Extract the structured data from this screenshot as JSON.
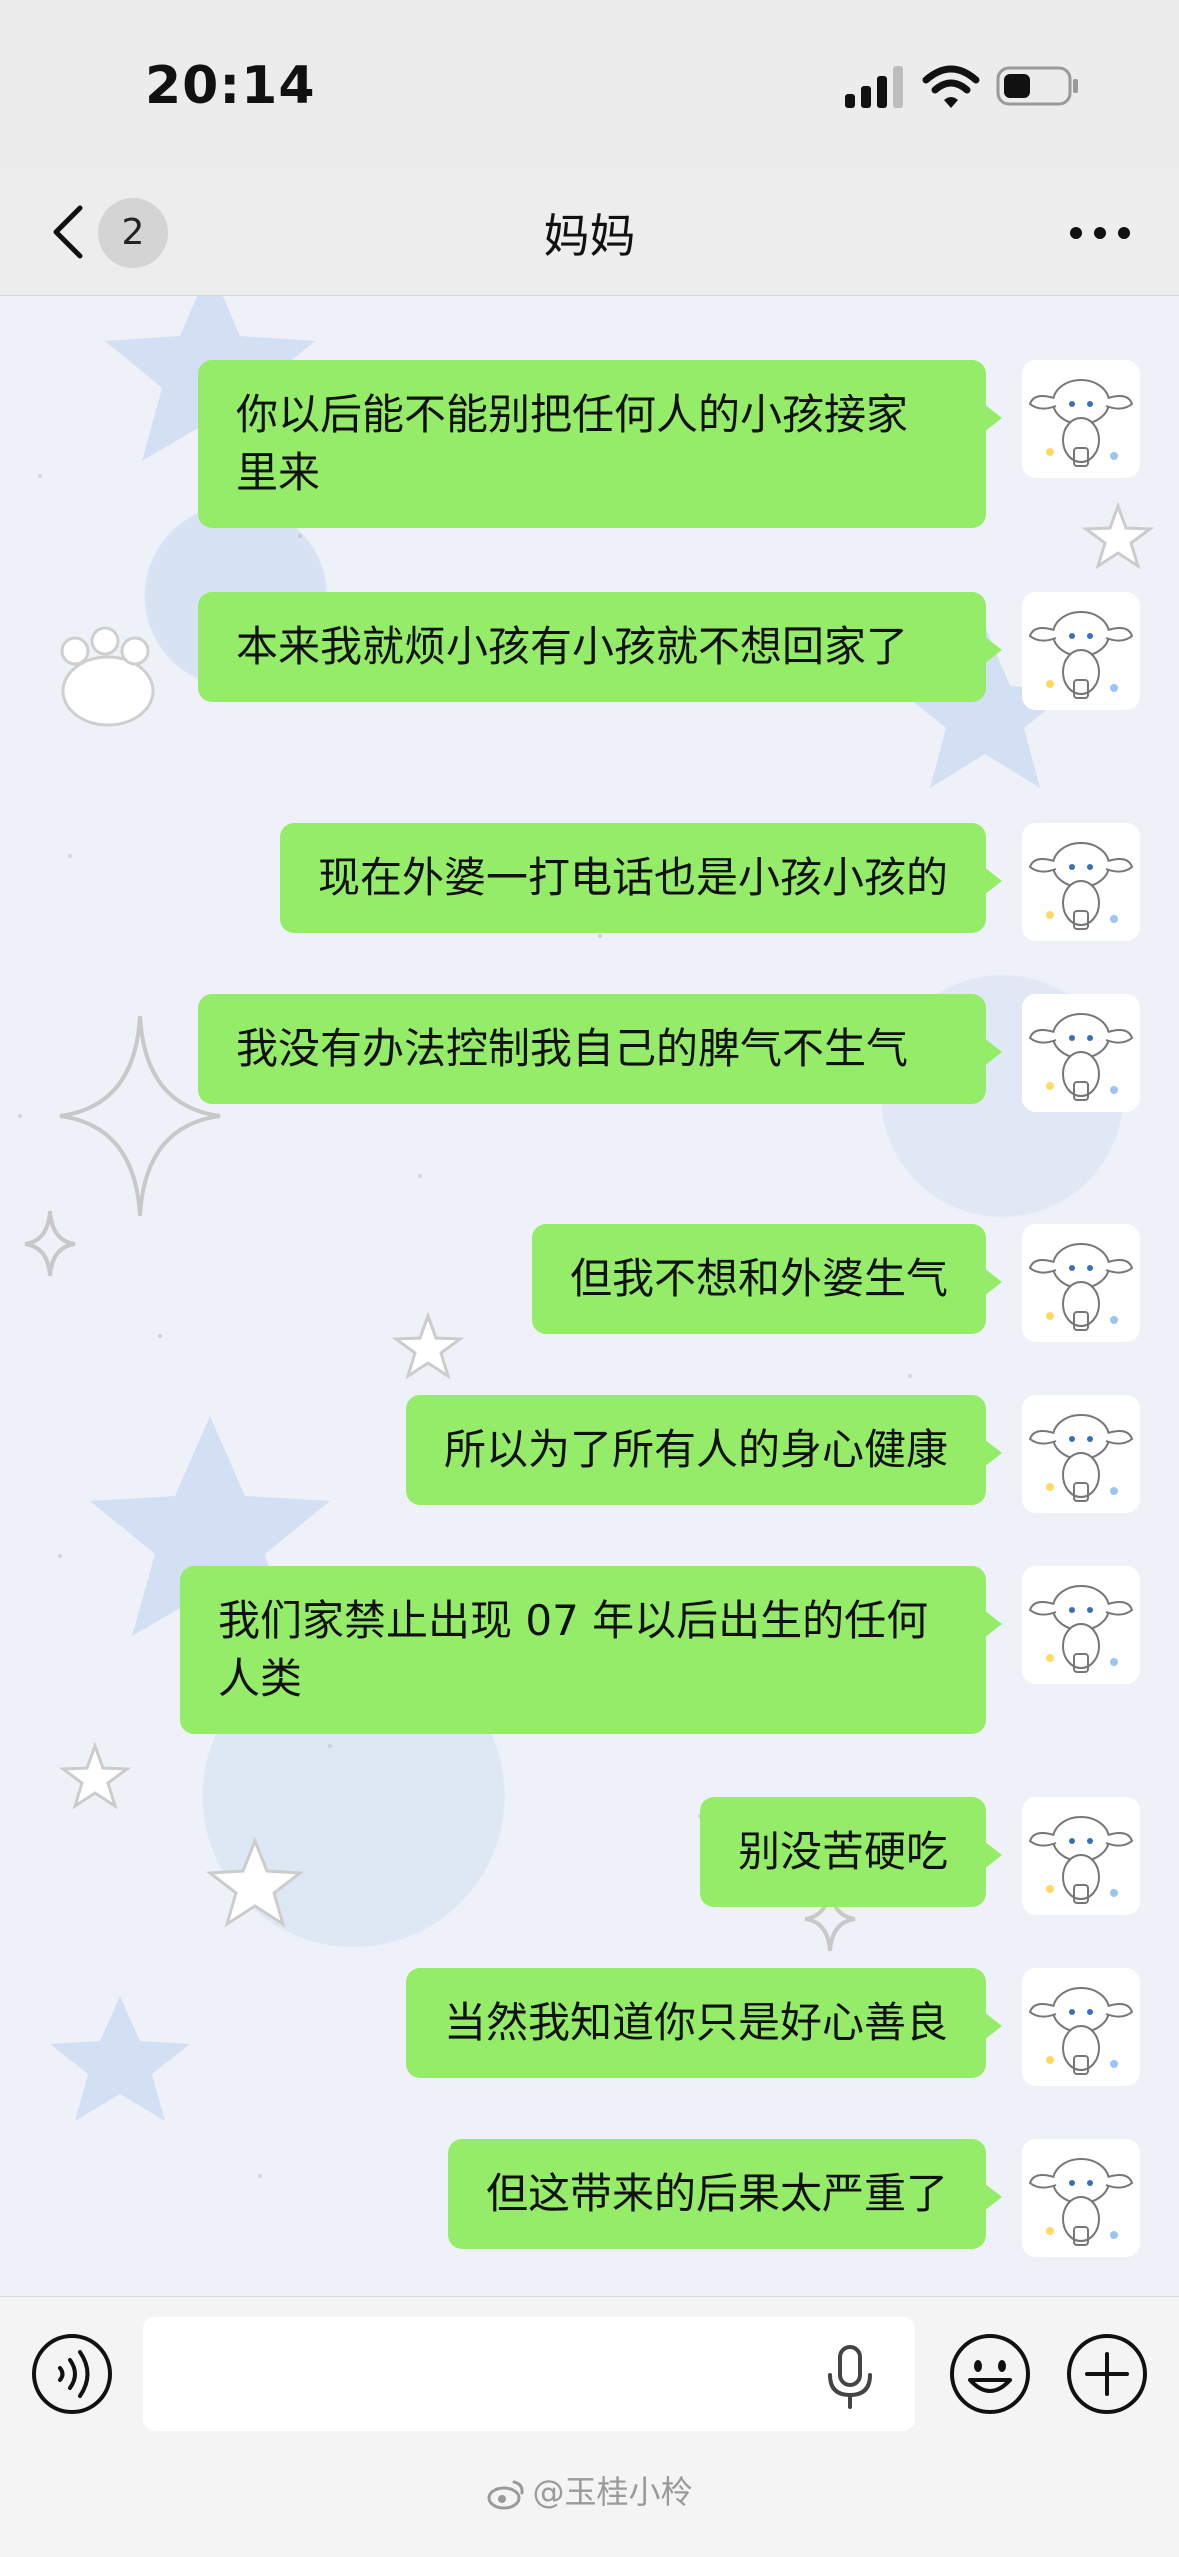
{
  "status_bar": {
    "time": "20:14"
  },
  "nav": {
    "unread_count": "2",
    "title": "妈妈"
  },
  "messages": [
    {
      "text": "你以后能不能别把任何人的小孩接家里来"
    },
    {
      "text": "本来我就烦小孩有小孩就不想回家了"
    },
    {
      "text": "现在外婆一打电话也是小孩小孩的"
    },
    {
      "text": "我没有办法控制我自己的脾气不生气"
    },
    {
      "text": "但我不想和外婆生气"
    },
    {
      "text": "所以为了所有人的身心健康"
    },
    {
      "text": "我们家禁止出现 07 年以后出生的任何人类"
    },
    {
      "text": "别没苦硬吃"
    },
    {
      "text": "当然我知道你只是好心善良"
    },
    {
      "text": "但这带来的后果太严重了"
    }
  ],
  "input": {
    "value": "",
    "placeholder": ""
  },
  "watermark": "@玉桂小柃",
  "colors": {
    "bubble": "#95ec69",
    "bar": "#ededed"
  }
}
